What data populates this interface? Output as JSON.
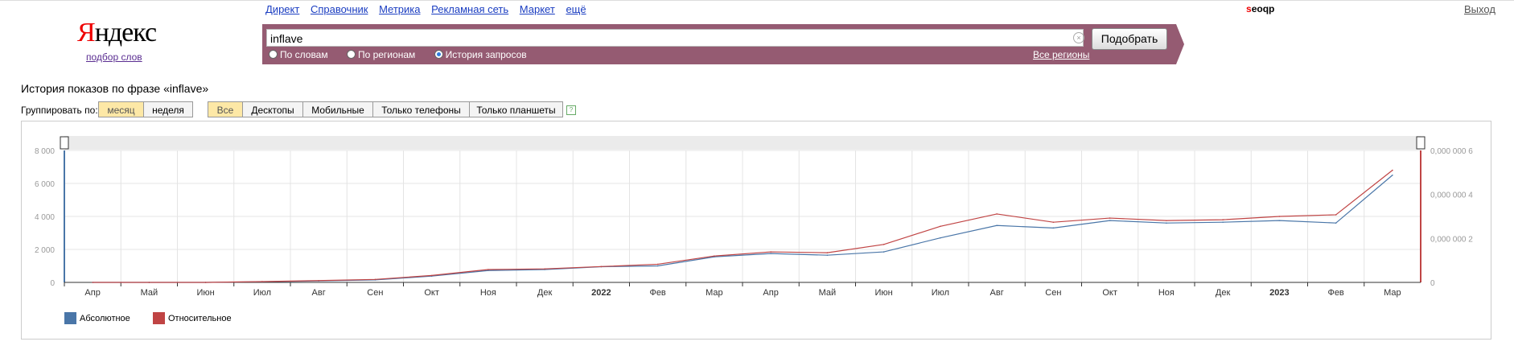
{
  "logo": {
    "text_red": "Я",
    "text_black": "ндекс",
    "subtitle": "подбор слов"
  },
  "toplinks": [
    "Директ",
    "Справочник",
    "Метрика",
    "Рекламная сеть",
    "Маркет",
    "ещё"
  ],
  "user": {
    "red": "s",
    "rest": "eoqp"
  },
  "logout": "Выход",
  "search": {
    "value": "inflave",
    "button": "Подобрать",
    "modes": [
      {
        "label": "По словам",
        "checked": false
      },
      {
        "label": "По регионам",
        "checked": false
      },
      {
        "label": "История запросов",
        "checked": true
      }
    ],
    "regions": "Все регионы"
  },
  "page": {
    "heading": "История показов по фразе «inflave»",
    "group_label": "Группировать по:",
    "group_buttons": [
      {
        "label": "месяц",
        "active": true
      },
      {
        "label": "неделя",
        "active": false
      }
    ],
    "device_buttons": [
      {
        "label": "Все",
        "active": true
      },
      {
        "label": "Десктопы",
        "active": false
      },
      {
        "label": "Мобильные",
        "active": false
      },
      {
        "label": "Только телефоны",
        "active": false
      },
      {
        "label": "Только планшеты",
        "active": false
      }
    ],
    "help": "?"
  },
  "colors": {
    "bar": "#955b72",
    "abs": "#4a76a8",
    "rel": "#c04444"
  },
  "chart_data": {
    "type": "line",
    "x": [
      "Апр",
      "Май",
      "Июн",
      "Июл",
      "Авг",
      "Сен",
      "Окт",
      "Ноя",
      "Дек",
      "2022",
      "Фев",
      "Мар",
      "Апр",
      "Май",
      "Июн",
      "Июл",
      "Авг",
      "Сен",
      "Окт",
      "Ноя",
      "Дек",
      "2023",
      "Фев",
      "Мар"
    ],
    "bold_ticks": [
      "2022",
      "2023"
    ],
    "left_ticks": [
      "8 000",
      "6 000",
      "4 000",
      "2 000",
      "0"
    ],
    "right_ticks": [
      "0,000 000 6",
      "0,000 000 4",
      "0,000 000 2",
      "0"
    ],
    "ylim_left": [
      0,
      8000
    ],
    "series": [
      {
        "name": "Абсолютное",
        "axis": "left",
        "values": [
          0,
          0,
          0,
          40,
          90,
          150,
          380,
          720,
          780,
          950,
          1000,
          1550,
          1750,
          1650,
          1850,
          2700,
          3450,
          3300,
          3750,
          3600,
          3650,
          3750,
          3600,
          6500
        ]
      },
      {
        "name": "Относительное",
        "axis": "right_scaled",
        "values": [
          0,
          0,
          0,
          50,
          110,
          180,
          420,
          780,
          820,
          960,
          1100,
          1600,
          1850,
          1800,
          2300,
          3400,
          4150,
          3650,
          3900,
          3750,
          3800,
          4000,
          4100,
          6800
        ]
      }
    ],
    "legend_placement": "bottom-left"
  }
}
